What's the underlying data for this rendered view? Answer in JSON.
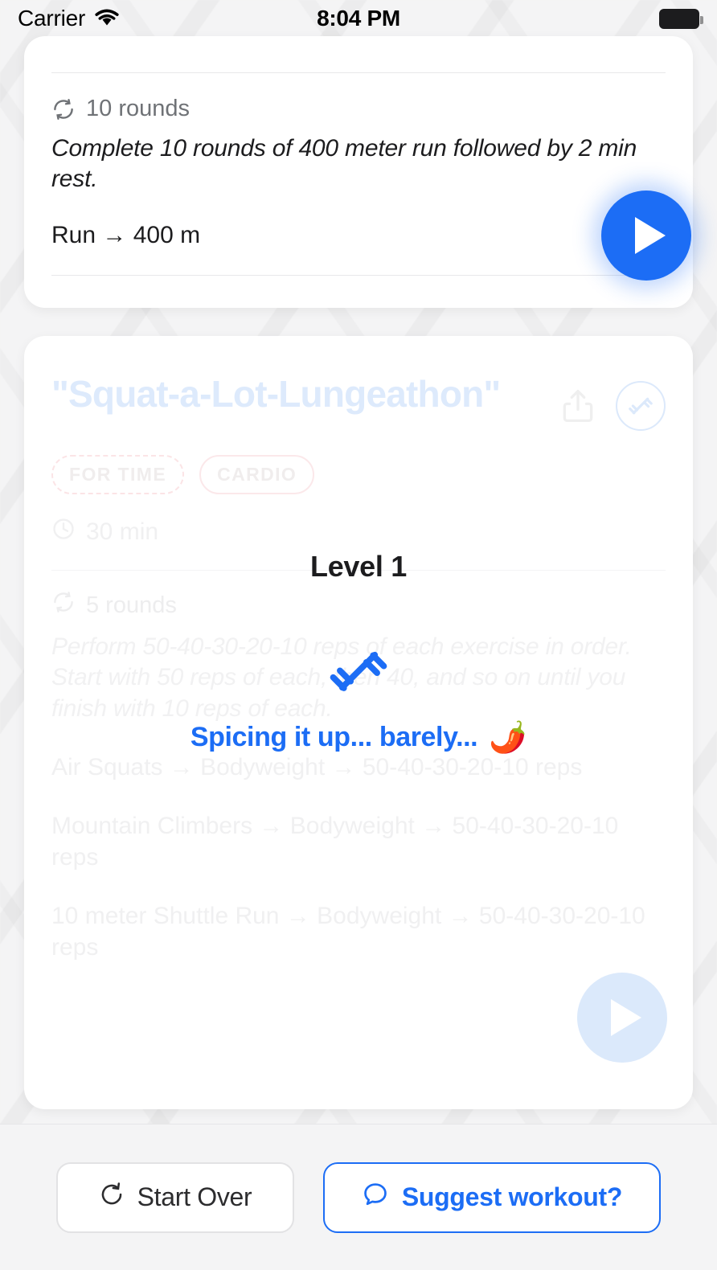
{
  "status_bar": {
    "carrier": "Carrier",
    "wifi_icon": "wifi-icon",
    "time": "8:04 PM",
    "battery_icon": "battery-full-icon"
  },
  "top_card": {
    "rounds_icon": "repeat-icon",
    "rounds": "10 rounds",
    "description": "Complete 10 rounds of 400 meter run followed by 2 min rest.",
    "exercises": [
      "Run → 400 m"
    ],
    "play_button_label": "play-icon"
  },
  "bottom_card": {
    "title": "\"Squat-a-Lot-Lungeathon\"",
    "share_icon": "share-icon",
    "equipment_icon": "dumbbell-icon",
    "badges": [
      {
        "label": "FOR TIME",
        "style": "dashed"
      },
      {
        "label": "CARDIO",
        "style": "solid"
      }
    ],
    "duration_icon": "clock-icon",
    "duration": "30 min",
    "rounds_icon": "repeat-icon",
    "rounds": "5 rounds",
    "description": "Perform 50-40-30-20-10 reps of each exercise in order. Start with 50 reps of each, then 40, and so on until you finish with 10 reps of each.",
    "exercises": [
      "Air Squats → Bodyweight → 50-40-30-20-10 reps",
      "Mountain Climbers → Bodyweight → 50-40-30-20-10 reps",
      "10 meter Shuttle Run → Bodyweight → 50-40-30-20-10 reps"
    ],
    "play_button_label": "play-icon"
  },
  "loading_overlay": {
    "level": "Level 1",
    "spinner_icon": "dumbbell-icon",
    "status_text": "Spicing it up... barely...",
    "status_emoji": "🌶️"
  },
  "bottom_bar": {
    "start_over": {
      "label": "Start Over",
      "icon": "restart-icon"
    },
    "suggest": {
      "label": "Suggest workout?",
      "icon": "chat-bubble-icon"
    }
  },
  "colors": {
    "accent_blue": "#1c6df5",
    "ghost_blue": "#ddeafc",
    "badge_pink": "#fbe4e6",
    "ghost_gray": "#f0f0f1",
    "card_bg": "#ffffff",
    "page_bg": "#f4f4f5"
  }
}
